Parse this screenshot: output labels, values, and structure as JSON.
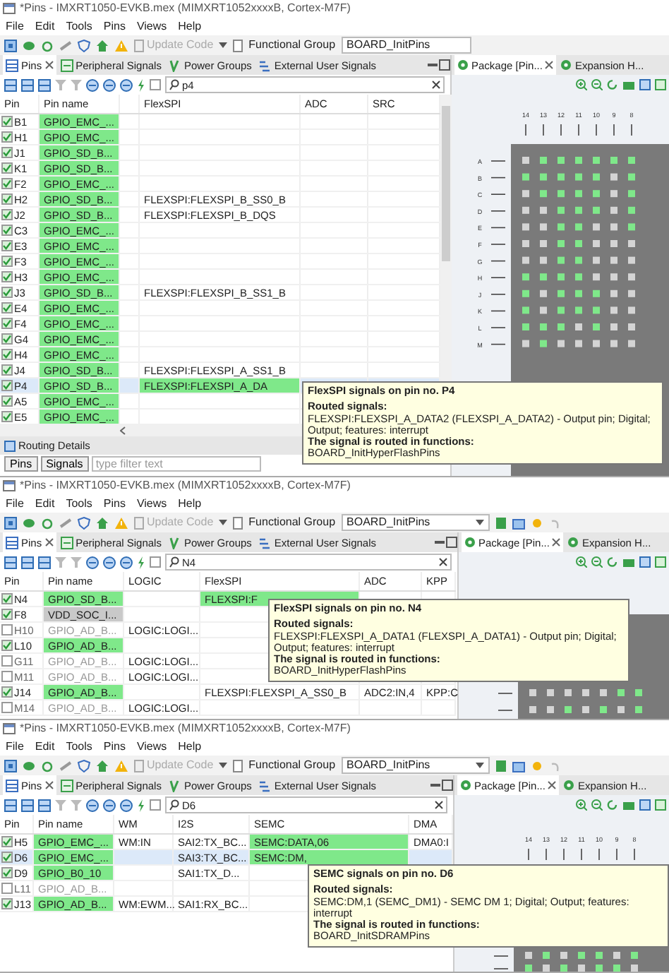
{
  "windows": [
    {
      "title": "*Pins - IMXRT1050-EVKB.mex (MIMXRT1052xxxxB, Cortex-M7F)",
      "menu": [
        "File",
        "Edit",
        "Tools",
        "Pins",
        "Views",
        "Help"
      ],
      "toolbar": {
        "update_code": {
          "label": "Update Code",
          "disabled": true
        },
        "group_label": "Functional Group",
        "group": "BOARD_InitPins",
        "group_extras": false
      },
      "tabs": [
        {
          "label": "Pins",
          "selected": true
        },
        {
          "label": "Peripheral Signals",
          "selected": false
        },
        {
          "label": "Power Groups",
          "selected": false
        },
        {
          "label": "External User Signals",
          "selected": false
        }
      ],
      "search": {
        "value": "p4"
      },
      "columns": [
        {
          "label": "Pin"
        },
        {
          "label": "Pin name"
        },
        {},
        {
          "label": "FlexSPI"
        },
        {
          "label": "ADC"
        },
        {
          "label": "SRC"
        }
      ],
      "rows": [
        {
          "checked": true,
          "routed": true,
          "power": false,
          "selected": false,
          "cells": [
            {
              "text": "B1"
            },
            {
              "text": "GPIO_EMC_..."
            },
            {},
            {},
            {},
            {}
          ]
        },
        {
          "checked": true,
          "routed": true,
          "power": false,
          "selected": false,
          "cells": [
            {
              "text": "H1"
            },
            {
              "text": "GPIO_EMC_..."
            },
            {},
            {},
            {},
            {}
          ]
        },
        {
          "checked": true,
          "routed": true,
          "power": false,
          "selected": false,
          "cells": [
            {
              "text": "J1"
            },
            {
              "text": "GPIO_SD_B..."
            },
            {},
            {},
            {},
            {}
          ]
        },
        {
          "checked": true,
          "routed": true,
          "power": false,
          "selected": false,
          "cells": [
            {
              "text": "K1"
            },
            {
              "text": "GPIO_SD_B..."
            },
            {},
            {},
            {},
            {}
          ]
        },
        {
          "checked": true,
          "routed": true,
          "power": false,
          "selected": false,
          "cells": [
            {
              "text": "F2"
            },
            {
              "text": "GPIO_EMC_..."
            },
            {},
            {},
            {},
            {}
          ]
        },
        {
          "checked": true,
          "routed": true,
          "power": false,
          "selected": false,
          "cells": [
            {
              "text": "H2"
            },
            {
              "text": "GPIO_SD_B..."
            },
            {},
            {
              "text": "FLEXSPI:FLEXSPI_B_SS0_B",
              "routed": false
            },
            {},
            {}
          ]
        },
        {
          "checked": true,
          "routed": true,
          "power": false,
          "selected": false,
          "cells": [
            {
              "text": "J2"
            },
            {
              "text": "GPIO_SD_B..."
            },
            {},
            {
              "text": "FLEXSPI:FLEXSPI_B_DQS",
              "routed": false
            },
            {},
            {}
          ]
        },
        {
          "checked": true,
          "routed": true,
          "power": false,
          "selected": false,
          "cells": [
            {
              "text": "C3"
            },
            {
              "text": "GPIO_EMC_..."
            },
            {},
            {},
            {},
            {}
          ]
        },
        {
          "checked": true,
          "routed": true,
          "power": false,
          "selected": false,
          "cells": [
            {
              "text": "E3"
            },
            {
              "text": "GPIO_EMC_..."
            },
            {},
            {},
            {},
            {}
          ]
        },
        {
          "checked": true,
          "routed": true,
          "power": false,
          "selected": false,
          "cells": [
            {
              "text": "F3"
            },
            {
              "text": "GPIO_EMC_..."
            },
            {},
            {},
            {},
            {}
          ]
        },
        {
          "checked": true,
          "routed": true,
          "power": false,
          "selected": false,
          "cells": [
            {
              "text": "H3"
            },
            {
              "text": "GPIO_EMC_..."
            },
            {},
            {},
            {},
            {}
          ]
        },
        {
          "checked": true,
          "routed": true,
          "power": false,
          "selected": false,
          "cells": [
            {
              "text": "J3"
            },
            {
              "text": "GPIO_SD_B..."
            },
            {},
            {
              "text": "FLEXSPI:FLEXSPI_B_SS1_B",
              "routed": false
            },
            {},
            {}
          ]
        },
        {
          "checked": true,
          "routed": true,
          "power": false,
          "selected": false,
          "cells": [
            {
              "text": "E4"
            },
            {
              "text": "GPIO_EMC_..."
            },
            {},
            {},
            {},
            {}
          ]
        },
        {
          "checked": true,
          "routed": true,
          "power": false,
          "selected": false,
          "cells": [
            {
              "text": "F4"
            },
            {
              "text": "GPIO_EMC_..."
            },
            {},
            {},
            {},
            {}
          ]
        },
        {
          "checked": true,
          "routed": true,
          "power": false,
          "selected": false,
          "cells": [
            {
              "text": "G4"
            },
            {
              "text": "GPIO_EMC_..."
            },
            {},
            {},
            {},
            {}
          ]
        },
        {
          "checked": true,
          "routed": true,
          "power": false,
          "selected": false,
          "cells": [
            {
              "text": "H4"
            },
            {
              "text": "GPIO_EMC_..."
            },
            {},
            {},
            {},
            {}
          ]
        },
        {
          "checked": true,
          "routed": true,
          "power": false,
          "selected": false,
          "cells": [
            {
              "text": "J4"
            },
            {
              "text": "GPIO_SD_B..."
            },
            {},
            {
              "text": "FLEXSPI:FLEXSPI_A_SS1_B",
              "routed": false
            },
            {},
            {}
          ]
        },
        {
          "checked": true,
          "routed": true,
          "power": false,
          "selected": true,
          "cells": [
            {
              "text": "P4"
            },
            {
              "text": "GPIO_SD_B..."
            },
            {},
            {
              "text": "FLEXSPI:FLEXSPI_A_DA",
              "routed": true
            },
            {},
            {}
          ]
        },
        {
          "checked": true,
          "routed": true,
          "power": false,
          "selected": false,
          "cells": [
            {
              "text": "A5"
            },
            {
              "text": "GPIO_EMC_..."
            },
            {},
            {},
            {},
            {}
          ]
        },
        {
          "checked": true,
          "routed": true,
          "power": false,
          "selected": false,
          "cells": [
            {
              "text": "E5"
            },
            {
              "text": "GPIO_EMC_..."
            },
            {},
            {},
            {},
            {}
          ]
        }
      ],
      "routing": {
        "title": "Routing Details",
        "buttons": [
          "Pins",
          "Signals"
        ],
        "filter_placeholder": "type filter text"
      },
      "tooltip": {
        "title": "FlexSPI signals on pin no. P4",
        "headings": [
          "Routed signals:",
          "The signal is routed in functions:"
        ],
        "signal": "FLEXSPI:FLEXSPI_A_DATA2 (FLEXSPI_A_DATA2) - Output pin; Digital; Output; features: interrupt",
        "function": "BOARD_InitHyperFlashPins"
      },
      "package": {
        "tabs": [
          {
            "label": "Package [Pin...",
            "selected": true
          },
          {
            "label": "Expansion H...",
            "selected": false
          }
        ],
        "columns": [
          "14",
          "13",
          "12",
          "11",
          "10",
          "9",
          "8"
        ],
        "rows": [
          {
            "label": "A",
            "pads": [
              false,
              true,
              true,
              true,
              true,
              true,
              true
            ]
          },
          {
            "label": "B",
            "pads": [
              true,
              true,
              true,
              true,
              true,
              false,
              true
            ]
          },
          {
            "label": "C",
            "pads": [
              false,
              true,
              true,
              true,
              true,
              false,
              true
            ]
          },
          {
            "label": "D",
            "pads": [
              false,
              false,
              true,
              true,
              true,
              false,
              true
            ]
          },
          {
            "label": "E",
            "pads": [
              false,
              false,
              true,
              true,
              false,
              false,
              true
            ]
          },
          {
            "label": "F",
            "pads": [
              false,
              false,
              true,
              true,
              false,
              false,
              false
            ]
          },
          {
            "label": "G",
            "pads": [
              false,
              false,
              true,
              true,
              false,
              false,
              false
            ]
          },
          {
            "label": "H",
            "pads": [
              true,
              true,
              true,
              true,
              false,
              false,
              false
            ]
          },
          {
            "label": "J",
            "pads": [
              true,
              false,
              true,
              true,
              true,
              false,
              false
            ]
          },
          {
            "label": "K",
            "pads": [
              true,
              false,
              true,
              true,
              true,
              false,
              false
            ]
          },
          {
            "label": "L",
            "pads": [
              true,
              true,
              true,
              false,
              true,
              false,
              false
            ]
          },
          {
            "label": "M",
            "pads": [
              false,
              true,
              false,
              false,
              false,
              false,
              false
            ]
          }
        ]
      }
    },
    {
      "title": "*Pins - IMXRT1050-EVKB.mex (MIMXRT1052xxxxB, Cortex-M7F)",
      "menu": [
        "File",
        "Edit",
        "Tools",
        "Pins",
        "Views",
        "Help"
      ],
      "toolbar": {
        "update_code": {
          "label": "Update Code",
          "disabled": true
        },
        "group_label": "Functional Group",
        "group": "BOARD_InitPins",
        "group_extras": true
      },
      "tabs": [
        {
          "label": "Pins",
          "selected": true
        },
        {
          "label": "Peripheral Signals",
          "selected": false
        },
        {
          "label": "Power Groups",
          "selected": false
        },
        {
          "label": "External User Signals",
          "selected": false
        }
      ],
      "search": {
        "value": "N4"
      },
      "columns": [
        {
          "label": "Pin"
        },
        {
          "label": "Pin name"
        },
        {
          "label": "LOGIC"
        },
        {
          "label": "FlexSPI"
        },
        {
          "label": "ADC"
        },
        {
          "label": "KPP"
        }
      ],
      "rows": [
        {
          "checked": true,
          "routed": true,
          "power": false,
          "selected": false,
          "cells": [
            {
              "text": "N4"
            },
            {
              "text": "GPIO_SD_B..."
            },
            {},
            {
              "text": "FLEXSPI:F",
              "routed": true
            },
            {},
            {}
          ]
        },
        {
          "checked": true,
          "routed": false,
          "power": true,
          "selected": false,
          "cells": [
            {
              "text": "F8"
            },
            {
              "text": "VDD_SOC_I..."
            },
            {},
            {},
            {},
            {}
          ]
        },
        {
          "checked": false,
          "routed": false,
          "power": false,
          "selected": false,
          "cells": [
            {
              "text": "H10"
            },
            {
              "text": "GPIO_AD_B..."
            },
            {
              "text": "LOGIC:LOGI...",
              "routed": false
            },
            {},
            {},
            {}
          ]
        },
        {
          "checked": true,
          "routed": true,
          "power": false,
          "selected": false,
          "cells": [
            {
              "text": "L10"
            },
            {
              "text": "GPIO_AD_B..."
            },
            {},
            {},
            {},
            {}
          ]
        },
        {
          "checked": false,
          "routed": false,
          "power": false,
          "selected": false,
          "cells": [
            {
              "text": "G11"
            },
            {
              "text": "GPIO_AD_B..."
            },
            {
              "text": "LOGIC:LOGI...",
              "routed": false
            },
            {},
            {},
            {}
          ]
        },
        {
          "checked": false,
          "routed": false,
          "power": false,
          "selected": false,
          "cells": [
            {
              "text": "M11"
            },
            {
              "text": "GPIO_AD_B..."
            },
            {
              "text": "LOGIC:LOGI...",
              "routed": false
            },
            {},
            {},
            {}
          ]
        },
        {
          "checked": true,
          "routed": true,
          "power": false,
          "selected": false,
          "cells": [
            {
              "text": "J14"
            },
            {
              "text": "GPIO_AD_B..."
            },
            {},
            {
              "text": "FLEXSPI:FLEXSPI_A_SS0_B",
              "routed": false
            },
            {
              "text": "ADC2:IN,4",
              "routed": false
            },
            {
              "text": "KPP:C",
              "routed": false
            }
          ]
        },
        {
          "checked": false,
          "routed": false,
          "power": false,
          "selected": false,
          "cells": [
            {
              "text": "M14"
            },
            {
              "text": "GPIO_AD_B..."
            },
            {
              "text": "LOGIC:LOGI...",
              "routed": false
            },
            {},
            {},
            {}
          ]
        }
      ],
      "tooltip": {
        "title": "FlexSPI signals on pin no. N4",
        "headings": [
          "Routed signals:",
          "The signal is routed in functions:"
        ],
        "signal": "FLEXSPI:FLEXSPI_A_DATA1 (FLEXSPI_A_DATA1) - Output pin; Digital; Output; features: interrupt",
        "function": "BOARD_InitHyperFlashPins"
      },
      "package": {
        "tabs": [
          {
            "label": "Package [Pin...",
            "selected": true
          },
          {
            "label": "Expansion H...",
            "selected": false
          }
        ],
        "rows": [
          {
            "pads": [
              false,
              false,
              false,
              false,
              false,
              true,
              true
            ]
          },
          {
            "pads": [
              false,
              false,
              true,
              false,
              true,
              false,
              true
            ]
          }
        ]
      }
    },
    {
      "title": "*Pins - IMXRT1050-EVKB.mex (MIMXRT1052xxxxB, Cortex-M7F)",
      "menu": [
        "File",
        "Edit",
        "Tools",
        "Pins",
        "Views",
        "Help"
      ],
      "toolbar": {
        "update_code": {
          "label": "Update Code",
          "disabled": true
        },
        "group_label": "Functional Group",
        "group": "BOARD_InitPins",
        "group_extras": true
      },
      "tabs": [
        {
          "label": "Pins",
          "selected": true
        },
        {
          "label": "Peripheral Signals",
          "selected": false
        },
        {
          "label": "Power Groups",
          "selected": false
        },
        {
          "label": "External User Signals",
          "selected": false
        }
      ],
      "search": {
        "value": "D6"
      },
      "columns": [
        {
          "label": "Pin"
        },
        {
          "label": "Pin name"
        },
        {
          "label": "WM"
        },
        {
          "label": "I2S"
        },
        {
          "label": "SEMC"
        },
        {
          "label": "DMA"
        }
      ],
      "rows": [
        {
          "checked": true,
          "routed": true,
          "power": false,
          "selected": false,
          "cells": [
            {
              "text": "H5"
            },
            {
              "text": "GPIO_EMC_..."
            },
            {
              "text": "WM:IN",
              "routed": false
            },
            {
              "text": "SAI2:TX_BC...",
              "routed": false
            },
            {
              "text": "SEMC:DATA,06",
              "routed": true
            },
            {
              "text": "DMA0:I",
              "routed": false
            }
          ]
        },
        {
          "checked": true,
          "routed": true,
          "power": false,
          "selected": true,
          "cells": [
            {
              "text": "D6"
            },
            {
              "text": "GPIO_EMC_..."
            },
            {},
            {
              "text": "SAI3:TX_BC...",
              "routed": false
            },
            {
              "text": "SEMC:DM,",
              "routed": true
            },
            {}
          ]
        },
        {
          "checked": true,
          "routed": true,
          "power": false,
          "selected": false,
          "cells": [
            {
              "text": "D9"
            },
            {
              "text": "GPIO_B0_10"
            },
            {},
            {
              "text": "SAI1:TX_D...",
              "routed": false
            },
            {},
            {}
          ]
        },
        {
          "checked": false,
          "routed": false,
          "power": false,
          "selected": false,
          "cells": [
            {
              "text": "L11"
            },
            {
              "text": "GPIO_AD_B..."
            },
            {},
            {},
            {},
            {}
          ]
        },
        {
          "checked": true,
          "routed": true,
          "power": false,
          "selected": false,
          "cells": [
            {
              "text": "J13"
            },
            {
              "text": "GPIO_AD_B..."
            },
            {
              "text": "WM:EWM...",
              "routed": false
            },
            {
              "text": "SAI1:RX_BC...",
              "routed": false
            },
            {},
            {}
          ]
        }
      ],
      "tooltip": {
        "title": "SEMC signals on pin no. D6",
        "headings": [
          "Routed signals:",
          "The signal is routed in functions:"
        ],
        "signal": "SEMC:DM,1 (SEMC_DM1) - SEMC DM 1; Digital; Output; features: interrupt",
        "function": "BOARD_InitSDRAMPins"
      },
      "package": {
        "tabs": [
          {
            "label": "Package [Pin...",
            "selected": true
          },
          {
            "label": "Expansion H...",
            "selected": false
          }
        ],
        "columns": [
          "14",
          "13",
          "12",
          "11",
          "10",
          "9",
          "8"
        ],
        "rows": [
          {
            "pads": [
              false,
              true,
              false,
              true,
              true,
              false,
              true
            ]
          },
          {
            "pads": [
              true,
              false,
              true,
              false,
              true,
              true,
              false
            ]
          }
        ]
      }
    }
  ]
}
